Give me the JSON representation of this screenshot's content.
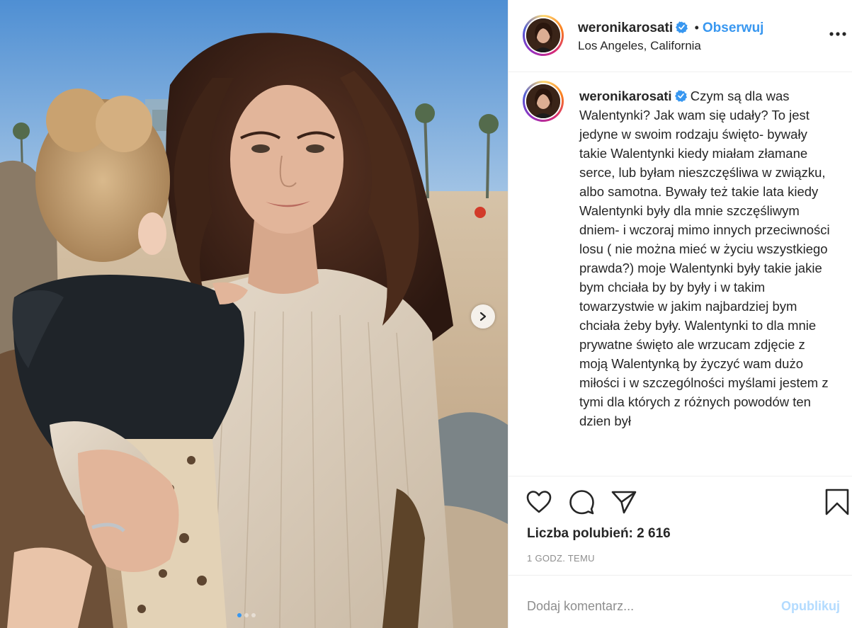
{
  "post": {
    "username": "weronikarosati",
    "verified": true,
    "separator": "•",
    "follow_label": "Obserwuj",
    "location": "Los Angeles, California",
    "more_icon": "more-horizontal-icon"
  },
  "caption": {
    "username": "weronikarosati",
    "text": "Czym są dla was Walentynki? Jak wam się udały? To jest jedyne w swoim rodzaju święto- bywały takie Walentynki kiedy miałam złamane serce, lub byłam nieszczęśliwa w związku, albo samotna. Bywały też takie lata kiedy Walentynki były dla mnie szczęśliwym dniem- i wczoraj mimo innych przeciwności losu ( nie można mieć w życiu wszystkiego prawda?) moje Walentynki były takie jakie bym chciała by by były i w takim towarzystwie w jakim najbardziej bym chciała żeby były. Walentynki to dla mnie prywatne święto ale wrzucam zdjęcie z moją Walentynką by życzyć wam dużo miłości i w szczególności myślami jestem z tymi dla których z różnych powodów ten dzien był"
  },
  "actions": {
    "like_icon": "heart-icon",
    "comment_icon": "comment-icon",
    "share_icon": "share-icon",
    "save_icon": "bookmark-icon",
    "likes_text": "Liczba polubień: 2 616",
    "timestamp": "1 GODZ. TEMU"
  },
  "comment": {
    "placeholder": "Dodaj komentarz...",
    "publish_label": "Opublikuj"
  },
  "carousel": {
    "next_icon": "chevron-right-icon",
    "slide_count": 3,
    "active_index": 0
  },
  "colors": {
    "accent": "#3897f0",
    "publish_disabled": "#b3dbff",
    "muted": "#8e8e8e",
    "border": "#efefef"
  }
}
